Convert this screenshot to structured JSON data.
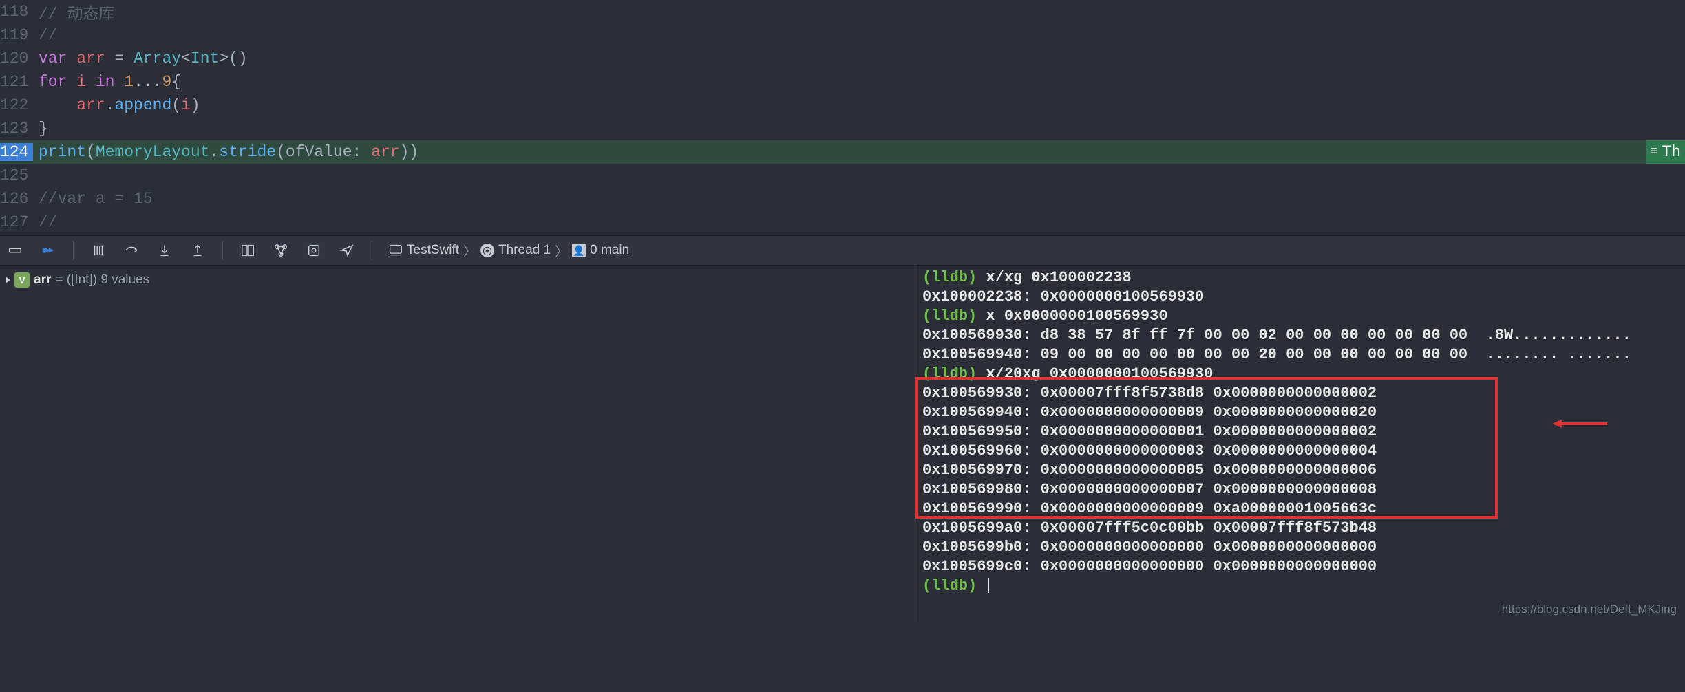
{
  "editor": {
    "lines": [
      {
        "num": "118",
        "tokens": [
          {
            "cls": "comment",
            "t": "// 动态库"
          }
        ]
      },
      {
        "num": "119",
        "tokens": [
          {
            "cls": "comment",
            "t": "//"
          }
        ]
      },
      {
        "num": "120",
        "tokens": [
          {
            "cls": "kw",
            "t": "var"
          },
          {
            "cls": "plain",
            "t": " "
          },
          {
            "cls": "var",
            "t": "arr"
          },
          {
            "cls": "plain",
            "t": " = "
          },
          {
            "cls": "type",
            "t": "Array"
          },
          {
            "cls": "plain",
            "t": "<"
          },
          {
            "cls": "type",
            "t": "Int"
          },
          {
            "cls": "plain",
            "t": ">()"
          }
        ]
      },
      {
        "num": "121",
        "tokens": [
          {
            "cls": "kw",
            "t": "for"
          },
          {
            "cls": "plain",
            "t": " "
          },
          {
            "cls": "var",
            "t": "i"
          },
          {
            "cls": "plain",
            "t": " "
          },
          {
            "cls": "kw",
            "t": "in"
          },
          {
            "cls": "plain",
            "t": " "
          },
          {
            "cls": "num",
            "t": "1"
          },
          {
            "cls": "plain",
            "t": "..."
          },
          {
            "cls": "num",
            "t": "9"
          },
          {
            "cls": "plain",
            "t": "{"
          }
        ]
      },
      {
        "num": "122",
        "tokens": [
          {
            "cls": "plain",
            "t": "    "
          },
          {
            "cls": "var",
            "t": "arr"
          },
          {
            "cls": "plain",
            "t": "."
          },
          {
            "cls": "func",
            "t": "append"
          },
          {
            "cls": "plain",
            "t": "("
          },
          {
            "cls": "var",
            "t": "i"
          },
          {
            "cls": "plain",
            "t": ")"
          }
        ]
      },
      {
        "num": "123",
        "tokens": [
          {
            "cls": "plain",
            "t": "}"
          }
        ]
      },
      {
        "num": "124",
        "highlighted": true,
        "tokens": [
          {
            "cls": "func",
            "t": "print"
          },
          {
            "cls": "plain",
            "t": "("
          },
          {
            "cls": "type",
            "t": "MemoryLayout"
          },
          {
            "cls": "plain",
            "t": "."
          },
          {
            "cls": "func",
            "t": "stride"
          },
          {
            "cls": "plain",
            "t": "(ofValue: "
          },
          {
            "cls": "var",
            "t": "arr"
          },
          {
            "cls": "plain",
            "t": "))"
          }
        ]
      },
      {
        "num": "125",
        "tokens": []
      },
      {
        "num": "126",
        "tokens": [
          {
            "cls": "comment",
            "t": "//var a = 15"
          }
        ]
      },
      {
        "num": "127",
        "tokens": [
          {
            "cls": "comment",
            "t": "//"
          }
        ]
      }
    ],
    "highlight_badge": "Th"
  },
  "breadcrumb": {
    "project": "TestSwift",
    "thread": "Thread 1",
    "frame": "0 main"
  },
  "variables": {
    "badge": "V",
    "name": "arr",
    "type": "([Int])",
    "summary": "9 values"
  },
  "console": {
    "lines": [
      {
        "prompt": true,
        "cmd": "x/xg 0x100002238"
      },
      {
        "text": "0x100002238: 0x0000000100569930"
      },
      {
        "prompt": true,
        "cmd": "x 0x0000000100569930"
      },
      {
        "text": "0x100569930: d8 38 57 8f ff 7f 00 00 02 00 00 00 00 00 00 00  .8W............."
      },
      {
        "text": "0x100569940: 09 00 00 00 00 00 00 00 20 00 00 00 00 00 00 00  ........ ......."
      },
      {
        "prompt": true,
        "cmd": "x/20xg 0x0000000100569930"
      },
      {
        "text": "0x100569930: 0x00007fff8f5738d8 0x0000000000000002"
      },
      {
        "text": "0x100569940: 0x0000000000000009 0x0000000000000020"
      },
      {
        "text": "0x100569950: 0x0000000000000001 0x0000000000000002"
      },
      {
        "text": "0x100569960: 0x0000000000000003 0x0000000000000004"
      },
      {
        "text": "0x100569970: 0x0000000000000005 0x0000000000000006"
      },
      {
        "text": "0x100569980: 0x0000000000000007 0x0000000000000008"
      },
      {
        "text": "0x100569990: 0x0000000000000009 0xa00000001005663c"
      },
      {
        "text": "0x1005699a0: 0x00007fff5c0c00bb 0x00007fff8f573b48"
      },
      {
        "text": "0x1005699b0: 0x0000000000000000 0x0000000000000000"
      },
      {
        "text": "0x1005699c0: 0x0000000000000000 0x0000000000000000"
      },
      {
        "prompt": true,
        "cmd": ""
      }
    ],
    "prompt_label": "(lldb)"
  },
  "watermark": "https://blog.csdn.net/Deft_MKJing"
}
